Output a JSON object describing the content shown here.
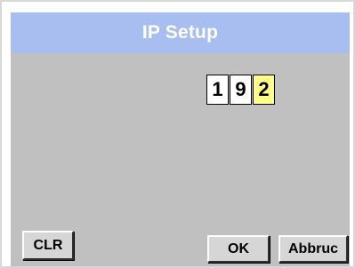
{
  "header": {
    "title": "IP Setup"
  },
  "ip_entry": {
    "digits": [
      "1",
      "9",
      "2"
    ],
    "active_index": 2
  },
  "buttons": {
    "clr": "CLR",
    "ok": "OK",
    "cancel": "Abbruc"
  },
  "colors": {
    "title_bar": "#a8bef0",
    "panel": "#c0c0c0",
    "active_digit": "#ffff88"
  }
}
